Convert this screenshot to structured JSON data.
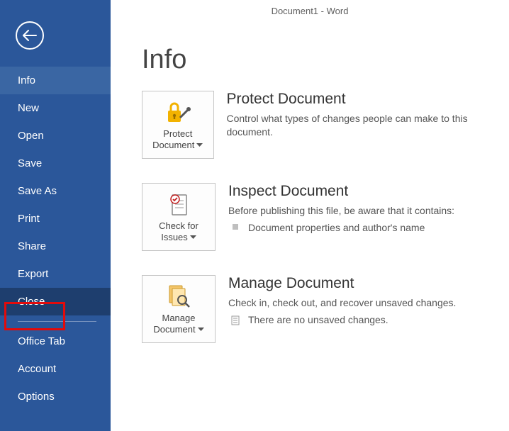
{
  "app_title": "Document1 - Word",
  "page_title": "Info",
  "sidebar": {
    "items": [
      {
        "label": "Info",
        "state": "active"
      },
      {
        "label": "New",
        "state": ""
      },
      {
        "label": "Open",
        "state": ""
      },
      {
        "label": "Save",
        "state": ""
      },
      {
        "label": "Save As",
        "state": ""
      },
      {
        "label": "Print",
        "state": ""
      },
      {
        "label": "Share",
        "state": ""
      },
      {
        "label": "Export",
        "state": ""
      },
      {
        "label": "Close",
        "state": "selected"
      }
    ],
    "items2": [
      {
        "label": "Office Tab"
      },
      {
        "label": "Account"
      },
      {
        "label": "Options"
      }
    ]
  },
  "sections": {
    "protect": {
      "title": "Protect Document",
      "desc": "Control what types of changes people can make to this document.",
      "tile_l1": "Protect",
      "tile_l2": "Document"
    },
    "inspect": {
      "title": "Inspect Document",
      "desc": "Before publishing this file, be aware that it contains:",
      "bullet": "Document properties and author's name",
      "tile_l1": "Check for",
      "tile_l2": "Issues"
    },
    "manage": {
      "title": "Manage Document",
      "desc": "Check in, check out, and recover unsaved changes.",
      "bullet": "There are no unsaved changes.",
      "tile_l1": "Manage",
      "tile_l2": "Document"
    }
  }
}
